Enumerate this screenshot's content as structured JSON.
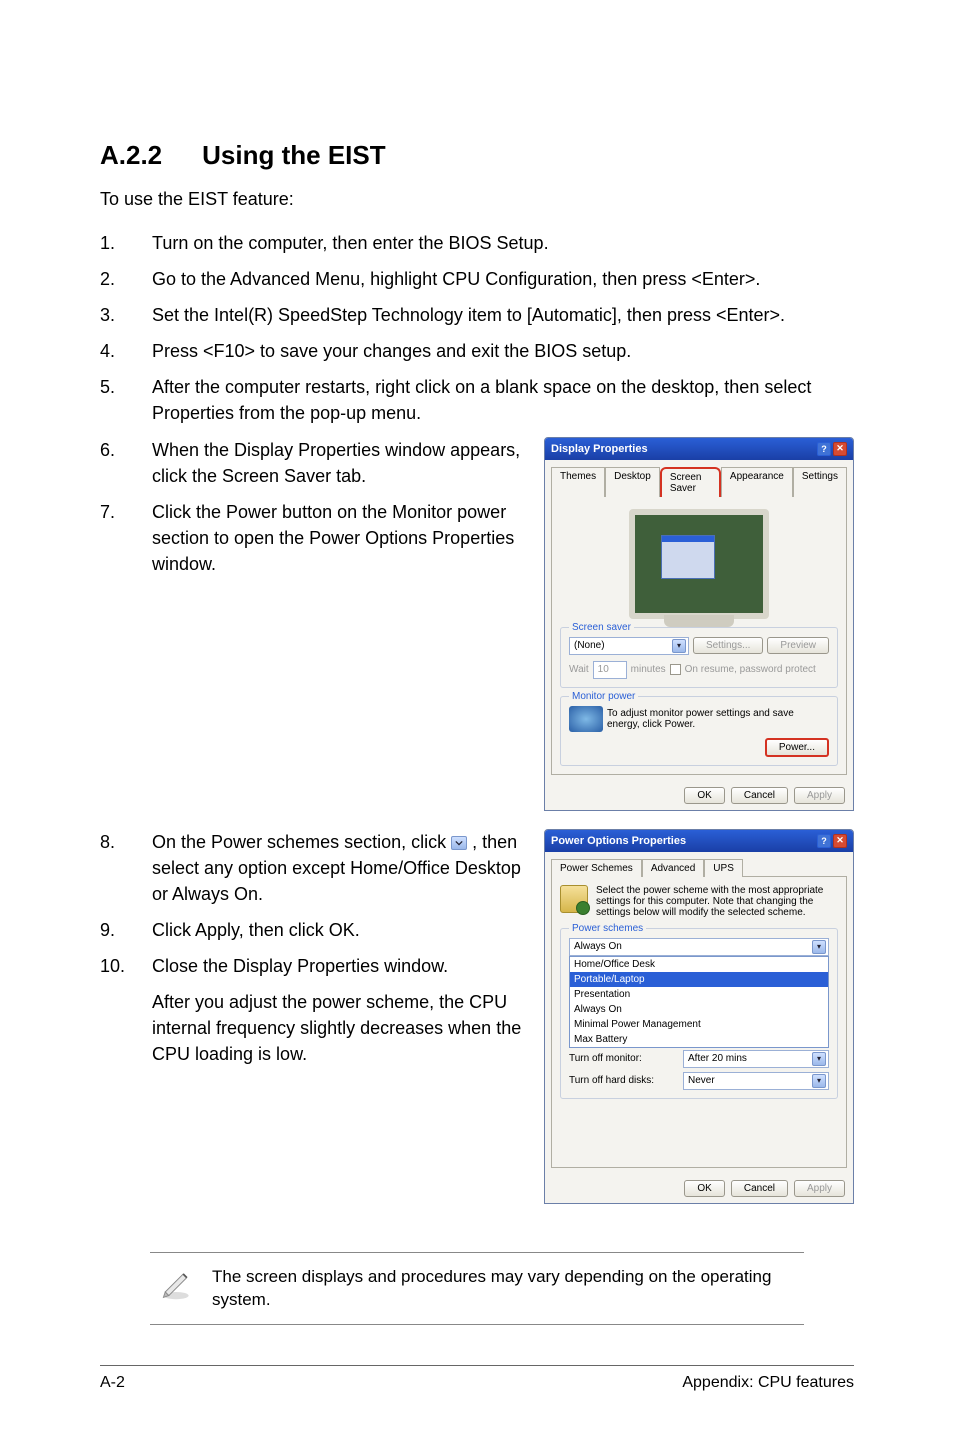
{
  "heading": {
    "number": "A.2.2",
    "title": "Using the EIST"
  },
  "intro": "To use the EIST feature:",
  "steps": [
    {
      "n": "1.",
      "t": "Turn on the computer, then enter the BIOS Setup."
    },
    {
      "n": "2.",
      "t": "Go to the Advanced Menu, highlight CPU Configuration, then press <Enter>."
    },
    {
      "n": "3.",
      "t": "Set the Intel(R) SpeedStep Technology item to [Automatic], then press <Enter>."
    },
    {
      "n": "4.",
      "t": "Press <F10> to save your changes and exit the BIOS setup."
    },
    {
      "n": "5.",
      "t": "After the computer restarts, right click on a blank space on the desktop, then select Properties from the pop-up menu."
    },
    {
      "n": "6.",
      "t": "When the Display Properties window appears, click the Screen Saver tab."
    },
    {
      "n": "7.",
      "t": "Click the Power button on the Monitor power section to open the Power Options Properties window."
    }
  ],
  "steps2": [
    {
      "n": "8.",
      "pre": "On the Power schemes section, click ",
      "post": ", then select any option except Home/Office Desktop or Always On."
    },
    {
      "n": "9.",
      "t": "Click Apply, then click OK."
    },
    {
      "n": "10.",
      "t": "Close the Display Properties window."
    }
  ],
  "aftertext": "After you adjust the power scheme, the CPU internal frequency slightly decreases when the CPU loading is low.",
  "display_props": {
    "title": "Display Properties",
    "tabs": [
      "Themes",
      "Desktop",
      "Screen Saver",
      "Appearance",
      "Settings"
    ],
    "screensaver_legend": "Screen saver",
    "screensaver_value": "(None)",
    "settings_btn": "Settings...",
    "preview_btn": "Preview",
    "wait_label": "Wait",
    "wait_value": "10",
    "wait_unit": "minutes",
    "resume_label": "On resume, password protect",
    "monitor_legend": "Monitor power",
    "monitor_text": "To adjust monitor power settings and save energy, click Power.",
    "power_btn": "Power...",
    "ok": "OK",
    "cancel": "Cancel",
    "apply": "Apply"
  },
  "power_opts": {
    "title": "Power Options Properties",
    "tabs": [
      "Power Schemes",
      "Advanced",
      "UPS"
    ],
    "desc": "Select the power scheme with the most appropriate settings for this computer. Note that changing the settings below will modify the selected scheme.",
    "schemes_legend": "Power schemes",
    "current": "Always On",
    "options": [
      "Home/Office Desk",
      "Portable/Laptop",
      "Presentation",
      "Always On",
      "Minimal Power Management",
      "Max Battery"
    ],
    "turn_off_monitor_label": "Turn off monitor:",
    "turn_off_monitor_val": "After 20 mins",
    "turn_off_hd_label": "Turn off hard disks:",
    "turn_off_hd_val": "Never",
    "ok": "OK",
    "cancel": "Cancel",
    "apply": "Apply"
  },
  "note": "The screen displays and procedures may vary depending on the operating system.",
  "footer": {
    "left": "A-2",
    "right": "Appendix: CPU features"
  }
}
